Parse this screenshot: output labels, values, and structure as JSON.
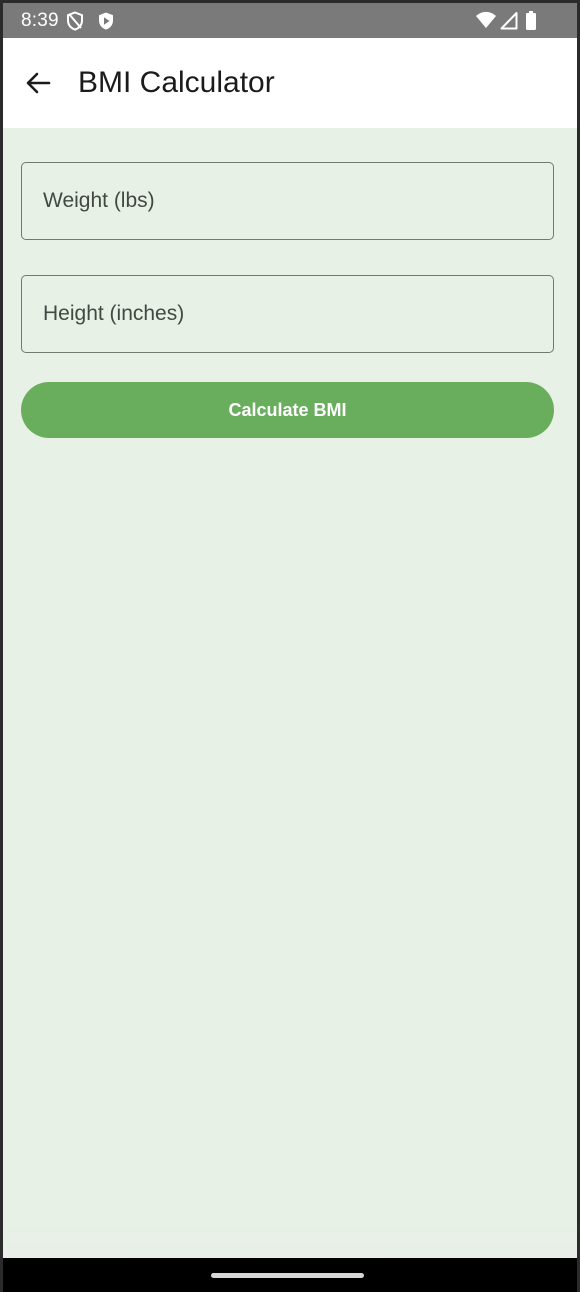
{
  "status_bar": {
    "time": "8:39",
    "left_icons": [
      "shield-icon",
      "play-shield-icon"
    ],
    "right_icons": [
      "wifi-icon",
      "cell-signal-icon",
      "battery-icon"
    ]
  },
  "app_bar": {
    "back_icon": "arrow-back-icon",
    "title": "BMI Calculator"
  },
  "form": {
    "weight": {
      "placeholder": "Weight (lbs)",
      "value": ""
    },
    "height": {
      "placeholder": "Height (inches)",
      "value": ""
    },
    "submit_label": "Calculate BMI"
  },
  "colors": {
    "background": "#e7f1e6",
    "app_bar": "#ffffff",
    "status_bar": "#7a7a7a",
    "button": "#69ae5d",
    "field_border": "#727872",
    "nav_bar": "#000000"
  }
}
